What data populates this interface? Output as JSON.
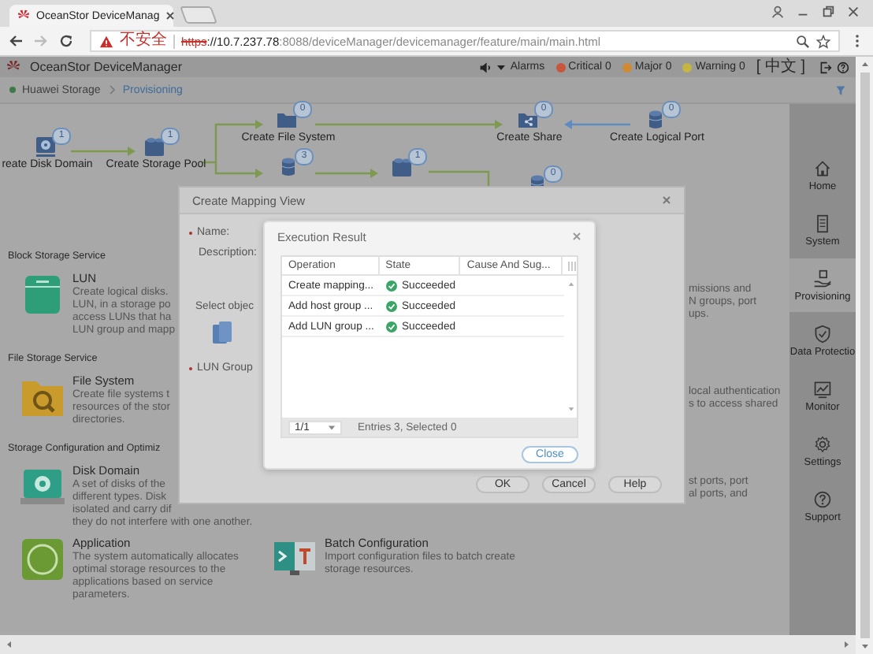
{
  "browser": {
    "tab_title": "OceanStor DeviceManag",
    "security_label": "不安全",
    "url_scheme": "https",
    "url_host": "://10.7.237.78",
    "url_rest": ":8088/deviceManager/devicemanager/feature/main/main.html"
  },
  "header": {
    "product": "OceanStor DeviceManager",
    "alarms_label": "Alarms",
    "alarms": [
      {
        "label": "Critical 0",
        "color": "#c8563c"
      },
      {
        "label": "Major 0",
        "color": "#d08a33"
      },
      {
        "label": "Warning 0",
        "color": "#c4b640"
      }
    ],
    "language": "[ 中文 ]"
  },
  "breadcrumb": [
    {
      "label": "Huawei Storage",
      "selected": false
    },
    {
      "label": "Provisioning",
      "selected": true
    }
  ],
  "workflow": {
    "nodes": [
      {
        "kind": "disk",
        "label": "reate Disk Domain",
        "count": "1"
      },
      {
        "kind": "pool",
        "label": "Create Storage Pool",
        "count": "1"
      },
      {
        "kind": "folder",
        "label": "Create File System",
        "count": "0"
      },
      {
        "kind": "share",
        "label": "Create Share",
        "count": "0"
      },
      {
        "kind": "port",
        "label": "Create Logical Port",
        "count": "0"
      },
      {
        "kind": "lun",
        "count": "3"
      },
      {
        "kind": "pool",
        "count": "1"
      },
      {
        "kind": "lun",
        "count": "0"
      }
    ]
  },
  "sections": [
    {
      "title": "Block Storage Service",
      "items": [
        {
          "kind": "lun",
          "title": "LUN",
          "lines": [
            "Create logical disks.",
            "LUN, in a storage po",
            "access LUNs that ha",
            "LUN group and mapp"
          ]
        }
      ]
    },
    {
      "title": "File Storage Service",
      "items": [
        {
          "kind": "filesystem",
          "title": "File System",
          "lines": [
            "Create file systems t",
            "resources of the stor",
            "directories."
          ]
        }
      ]
    },
    {
      "title": "Storage Configuration and Optimiz",
      "items": [
        {
          "kind": "diskdomain",
          "title": "Disk Domain",
          "lines": [
            "A set of disks of the",
            "different types. Disk",
            "isolated and carry dif",
            "they do not interfere with one another."
          ]
        },
        {
          "kind": "application",
          "title": "Application",
          "lines": [
            "The system automatically allocates",
            "optimal storage resources to the",
            "applications based on service",
            "parameters."
          ]
        },
        {
          "kind": "batch",
          "title": "Batch Configuration",
          "lines": [
            "Import configuration files to batch create",
            "storage resources."
          ]
        }
      ]
    }
  ],
  "right_fragments": [
    [
      "missions and",
      "N groups, port",
      "ups."
    ],
    [
      "local authentication",
      "s to access shared"
    ],
    [
      "st ports, port",
      "al ports, and"
    ]
  ],
  "nav": [
    {
      "kind": "home",
      "label": "Home",
      "selected": false
    },
    {
      "kind": "system",
      "label": "System",
      "selected": false
    },
    {
      "kind": "provisioning",
      "label": "Provisioning",
      "selected": true
    },
    {
      "kind": "protection",
      "label": "Data Protectio",
      "selected": false
    },
    {
      "kind": "monitor",
      "label": "Monitor",
      "selected": false
    },
    {
      "kind": "settings",
      "label": "Settings",
      "selected": false
    },
    {
      "kind": "support",
      "label": "Support",
      "selected": false
    }
  ],
  "mapping_dialog": {
    "title": "Create Mapping View",
    "name_field": {
      "label": "Name:",
      "required": true
    },
    "description_label": "Description:",
    "select_label": "Select objec",
    "lun_group_field": {
      "label": "LUN Group",
      "required": true
    },
    "buttons": [
      "OK",
      "Cancel",
      "Help"
    ]
  },
  "result_dialog": {
    "title": "Execution Result",
    "columns": [
      "Operation",
      "State",
      "Cause And Sug..."
    ],
    "rows": [
      {
        "operation": "Create mapping...",
        "state": "Succeeded"
      },
      {
        "operation": "Add host group ...",
        "state": "Succeeded"
      },
      {
        "operation": "Add LUN group ...",
        "state": "Succeeded"
      }
    ],
    "page": "1/1",
    "entries": "Entries 3, Selected 0",
    "close": "Close"
  }
}
